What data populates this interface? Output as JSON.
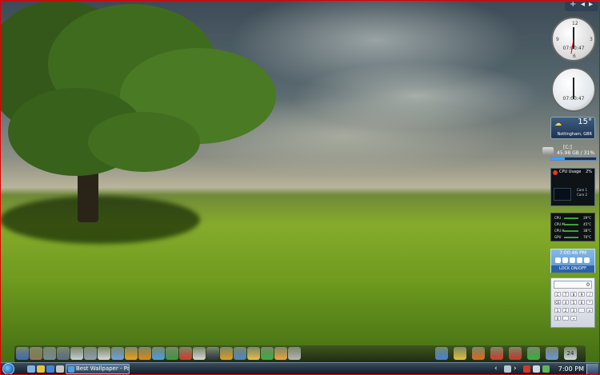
{
  "widgets": {
    "topbar": {
      "plus": "+",
      "minus": "-"
    },
    "clock1": {
      "digital": "07:00:47",
      "numerals": [
        "12",
        "3",
        "6",
        "9"
      ]
    },
    "clock2": {
      "digital": "07:00:47"
    },
    "weather": {
      "temperature": "15°",
      "location": "Nottingham, GBR"
    },
    "drive": {
      "label": "[C:]",
      "space": "45.98 GB / 31%",
      "used_fraction": 0.31
    },
    "cpu": {
      "title": "CPU Usage",
      "percent": "2%",
      "lines": [
        "Core 1",
        "Core 2"
      ]
    },
    "temps": {
      "rows": [
        {
          "label": "CPU",
          "value": "29°C"
        },
        {
          "label": "CPU M",
          "value": "45°C"
        },
        {
          "label": "CPU H",
          "value": "38°C"
        },
        {
          "label": "GPU",
          "value": "70°C"
        }
      ]
    },
    "timer": {
      "time": "7:00:46 PM",
      "lock_label": "LOCK ON/OFF"
    },
    "calculator": {
      "display": "0",
      "keys": [
        "C",
        "7",
        "8",
        "9",
        "/",
        "CE",
        "4",
        "5",
        "6",
        "*",
        "1",
        "2",
        "3",
        "-",
        "±",
        "0",
        ".",
        "+"
      ]
    }
  },
  "dock": {
    "icons": [
      {
        "name": "computer-icon",
        "color": "#3b6db8"
      },
      {
        "name": "books-icon",
        "color": "#8a7a52"
      },
      {
        "name": "tools-icon",
        "color": "#7a8a9a"
      },
      {
        "name": "network-icon",
        "color": "#5a6f84"
      },
      {
        "name": "paper-icon",
        "color": "#c9d2dc"
      },
      {
        "name": "shield-icon",
        "color": "#8fa1b3"
      },
      {
        "name": "drive-icon",
        "color": "#d9d9d9"
      },
      {
        "name": "recycle-bin-icon",
        "color": "#6fa4e8"
      },
      {
        "name": "info-icon",
        "color": "#f3a21a"
      },
      {
        "name": "gear-icon",
        "color": "#e08b1a"
      },
      {
        "name": "pinwheel-icon",
        "color": "#4aa1e8"
      },
      {
        "name": "map-icon",
        "color": "#3e9a3c"
      },
      {
        "name": "media-icon",
        "color": "#d63b2b"
      },
      {
        "name": "clapper-icon",
        "color": "#d8d8d8"
      },
      {
        "name": "terminal-icon",
        "color": "#2b3642"
      },
      {
        "name": "play-icon",
        "color": "#e0a020"
      },
      {
        "name": "window-icon",
        "color": "#4f88c7"
      },
      {
        "name": "folder-icon",
        "color": "#e8c14a"
      },
      {
        "name": "chart-icon",
        "color": "#3ab23a"
      },
      {
        "name": "notes-icon",
        "color": "#f0a83a"
      },
      {
        "name": "scissors-icon",
        "color": "#b8b8b8"
      },
      {
        "name": "ie-icon",
        "color": "#3f86d8"
      },
      {
        "name": "chrome-icon",
        "color": "#e7c23a"
      },
      {
        "name": "firefox-icon",
        "color": "#e06a1a"
      },
      {
        "name": "box-icon",
        "color": "#d83a2a"
      },
      {
        "name": "wrench-icon",
        "color": "#c8382a"
      },
      {
        "name": "phone-icon",
        "color": "#3ab23a"
      },
      {
        "name": "network-tray-icon",
        "color": "#6a9ad8"
      },
      {
        "name": "calendar-icon",
        "color": "#d0d8e4"
      }
    ],
    "calendar_day": "24"
  },
  "taskbar": {
    "window_title": "Best Wallpaper - Pag...",
    "clock": "7:00 PM",
    "quick_launch": [
      {
        "name": "show-desktop-ql-icon",
        "color": "#7fb1e6"
      },
      {
        "name": "folder-ql-icon",
        "color": "#e6c24b"
      },
      {
        "name": "browser-ql-icon",
        "color": "#3f86d8"
      },
      {
        "name": "media-ql-icon",
        "color": "#c4c4c4"
      }
    ],
    "tray": [
      {
        "name": "chevron-left-icon",
        "color": "#ffffff"
      },
      {
        "name": "network-status-icon",
        "color": "#b9c6d4"
      },
      {
        "name": "chevron-right-icon",
        "color": "#ffffff"
      },
      {
        "name": "antivirus-icon",
        "color": "#d23a2a"
      },
      {
        "name": "volume-icon",
        "color": "#cfd8e2"
      },
      {
        "name": "power-icon",
        "color": "#5ab85a"
      }
    ]
  }
}
